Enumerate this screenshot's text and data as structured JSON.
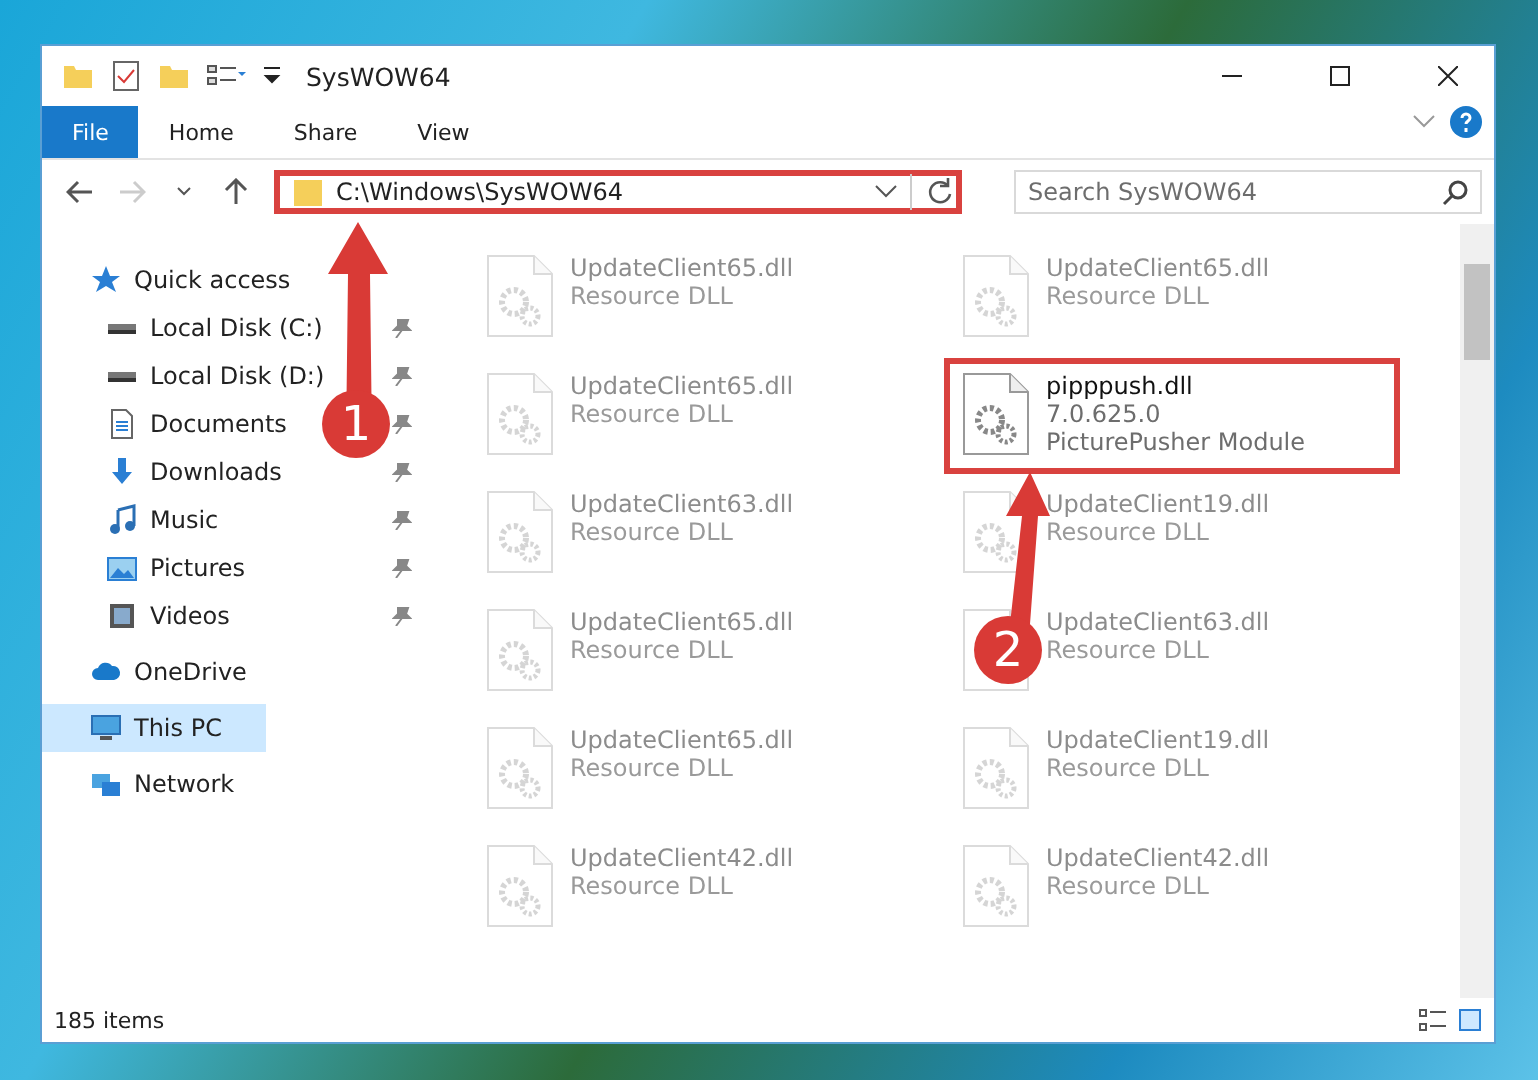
{
  "window": {
    "title": "SysWOW64"
  },
  "ribbon_tabs": [
    {
      "label": "File",
      "selected": true
    },
    {
      "label": "Home",
      "selected": false
    },
    {
      "label": "Share",
      "selected": false
    },
    {
      "label": "View",
      "selected": false
    }
  ],
  "address": {
    "path": "C:\\Windows\\SysWOW64",
    "highlighted": true
  },
  "search": {
    "placeholder": "Search SysWOW64"
  },
  "sidebar": {
    "items": [
      {
        "kind": "section",
        "label": "Quick access",
        "pinned": false,
        "selected": false
      },
      {
        "kind": "item",
        "label": "Local Disk (C:)",
        "pinned": true,
        "selected": false
      },
      {
        "kind": "item",
        "label": "Local Disk (D:)",
        "pinned": true,
        "selected": false
      },
      {
        "kind": "item",
        "label": "Documents",
        "pinned": true,
        "selected": false
      },
      {
        "kind": "item",
        "label": "Downloads",
        "pinned": true,
        "selected": false
      },
      {
        "kind": "item",
        "label": "Music",
        "pinned": true,
        "selected": false
      },
      {
        "kind": "item",
        "label": "Pictures",
        "pinned": true,
        "selected": false
      },
      {
        "kind": "item",
        "label": "Videos",
        "pinned": true,
        "selected": false
      },
      {
        "kind": "section",
        "label": "OneDrive",
        "pinned": false,
        "selected": false
      },
      {
        "kind": "section",
        "label": "This PC",
        "pinned": false,
        "selected": true
      },
      {
        "kind": "section",
        "label": "Network",
        "pinned": false,
        "selected": false
      }
    ]
  },
  "files": [
    {
      "name": "UpdateClient65.dll",
      "lines": [
        "Resource DLL"
      ],
      "faded": true,
      "highlighted": false
    },
    {
      "name": "UpdateClient65.dll",
      "lines": [
        "Resource DLL"
      ],
      "faded": true,
      "highlighted": false
    },
    {
      "name": "UpdateClient65.dll",
      "lines": [
        "Resource DLL"
      ],
      "faded": true,
      "highlighted": false
    },
    {
      "name": "pipppush.dll",
      "lines": [
        "7.0.625.0",
        "PicturePusher Module"
      ],
      "faded": false,
      "highlighted": true
    },
    {
      "name": "UpdateClient63.dll",
      "lines": [
        "Resource DLL"
      ],
      "faded": true,
      "highlighted": false
    },
    {
      "name": "UpdateClient19.dll",
      "lines": [
        "Resource DLL"
      ],
      "faded": true,
      "highlighted": false
    },
    {
      "name": "UpdateClient65.dll",
      "lines": [
        "Resource DLL"
      ],
      "faded": true,
      "highlighted": false
    },
    {
      "name": "UpdateClient63.dll",
      "lines": [
        "Resource DLL"
      ],
      "faded": true,
      "highlighted": false
    },
    {
      "name": "UpdateClient65.dll",
      "lines": [
        "Resource DLL"
      ],
      "faded": true,
      "highlighted": false
    },
    {
      "name": "UpdateClient19.dll",
      "lines": [
        "Resource DLL"
      ],
      "faded": true,
      "highlighted": false
    },
    {
      "name": "UpdateClient42.dll",
      "lines": [
        "Resource DLL"
      ],
      "faded": true,
      "highlighted": false
    },
    {
      "name": "UpdateClient42.dll",
      "lines": [
        "Resource DLL"
      ],
      "faded": true,
      "highlighted": false
    }
  ],
  "status_bar": {
    "count": "185 items"
  },
  "annotations": [
    {
      "label": "1"
    },
    {
      "label": "2"
    }
  ]
}
